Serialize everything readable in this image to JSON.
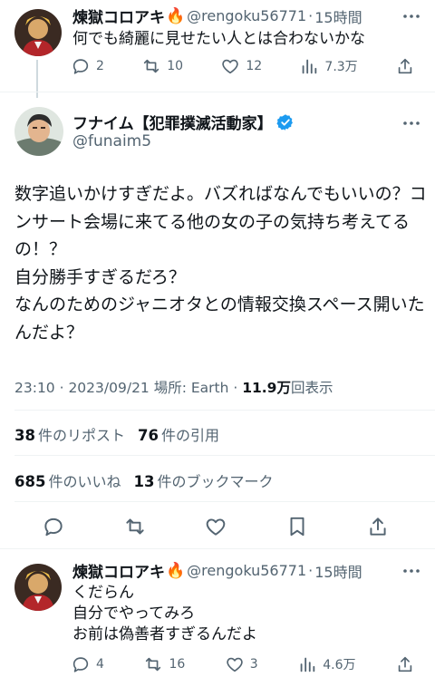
{
  "reply1": {
    "display_name": "煉獄コロアキ",
    "fire": "🔥",
    "handle": "@rengoku56771",
    "dot": "·",
    "time": "15時間",
    "text": "何でも綺麗に見せたい人とは合わないかな",
    "replies": "2",
    "retweets": "10",
    "likes": "12",
    "views": "7.3万"
  },
  "main": {
    "display_name": "フナイム【犯罪撲滅活動家】",
    "handle": "@funaim5",
    "text": "数字追いかけすぎだよ。バズればなんでもいいの？コンサート会場に来てる他の女の子の気持ち考えてるの！？\n自分勝手すぎるだろ？\nなんのためのジャニオタとの情報交換スペース開いたんだよ？",
    "timestamp": "23:10 · 2023/09/21 場所: Earth · ",
    "views_count": "11.9万",
    "views_label": "回表示",
    "reposts_count": "38",
    "reposts_label": "件のリポスト",
    "quotes_count": "76",
    "quotes_label": "件の引用",
    "likes_count": "685",
    "likes_label": "件のいいね",
    "bookmarks_count": "13",
    "bookmarks_label": "件のブックマーク"
  },
  "reply2": {
    "display_name": "煉獄コロアキ",
    "fire": "🔥",
    "handle": "@rengoku56771",
    "dot": "·",
    "time": "15時間",
    "text": "くだらん\n自分でやってみろ\nお前は偽善者すぎるんだよ",
    "replies": "4",
    "retweets": "16",
    "likes": "3",
    "views": "4.6万"
  },
  "colors": {
    "text": "#0f1419",
    "secondary": "#536471",
    "verified": "#1d9bf0",
    "divider": "#eff3f4"
  },
  "icons": [
    "more-icon",
    "reply-icon",
    "retweet-icon",
    "like-icon",
    "views-icon",
    "share-icon",
    "bookmark-icon",
    "verified-badge-icon"
  ]
}
